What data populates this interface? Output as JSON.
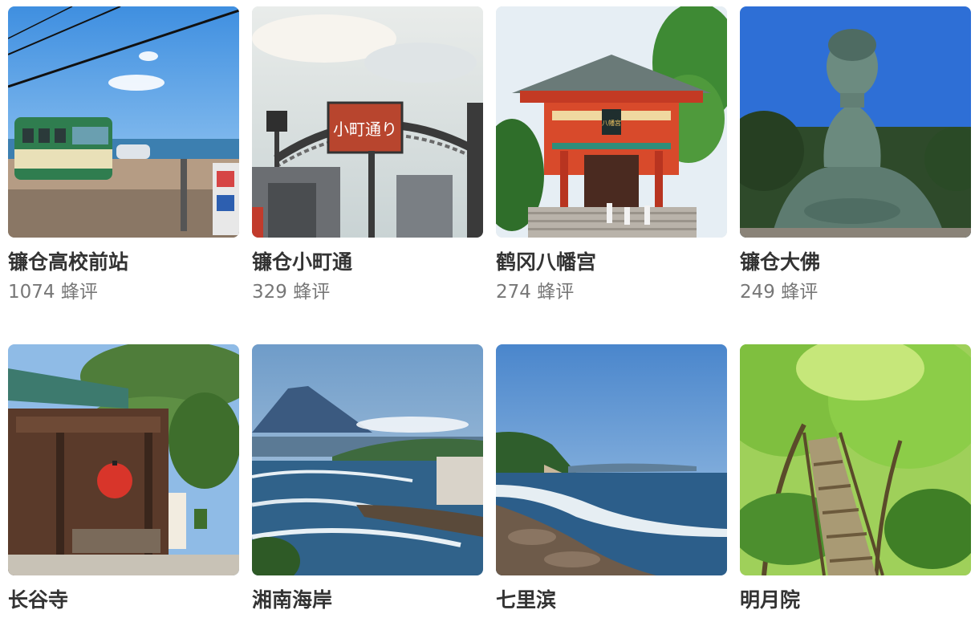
{
  "attractions": [
    {
      "name": "镰仓高校前站",
      "reviews": "1074 蜂评",
      "scene": "station"
    },
    {
      "name": "镰仓小町通",
      "reviews": "329 蜂评",
      "scene": "street"
    },
    {
      "name": "鹤冈八幡宫",
      "reviews": "274 蜂评",
      "scene": "shrine"
    },
    {
      "name": "镰仓大佛",
      "reviews": "249 蜂评",
      "scene": "buddha"
    },
    {
      "name": "长谷寺",
      "reviews": "",
      "scene": "temple"
    },
    {
      "name": "湘南海岸",
      "reviews": "",
      "scene": "coast"
    },
    {
      "name": "七里滨",
      "reviews": "",
      "scene": "beach"
    },
    {
      "name": "明月院",
      "reviews": "",
      "scene": "forest"
    }
  ],
  "signs": {
    "street_sign": "小町通り",
    "shrine_plaque": "八幡宮"
  }
}
